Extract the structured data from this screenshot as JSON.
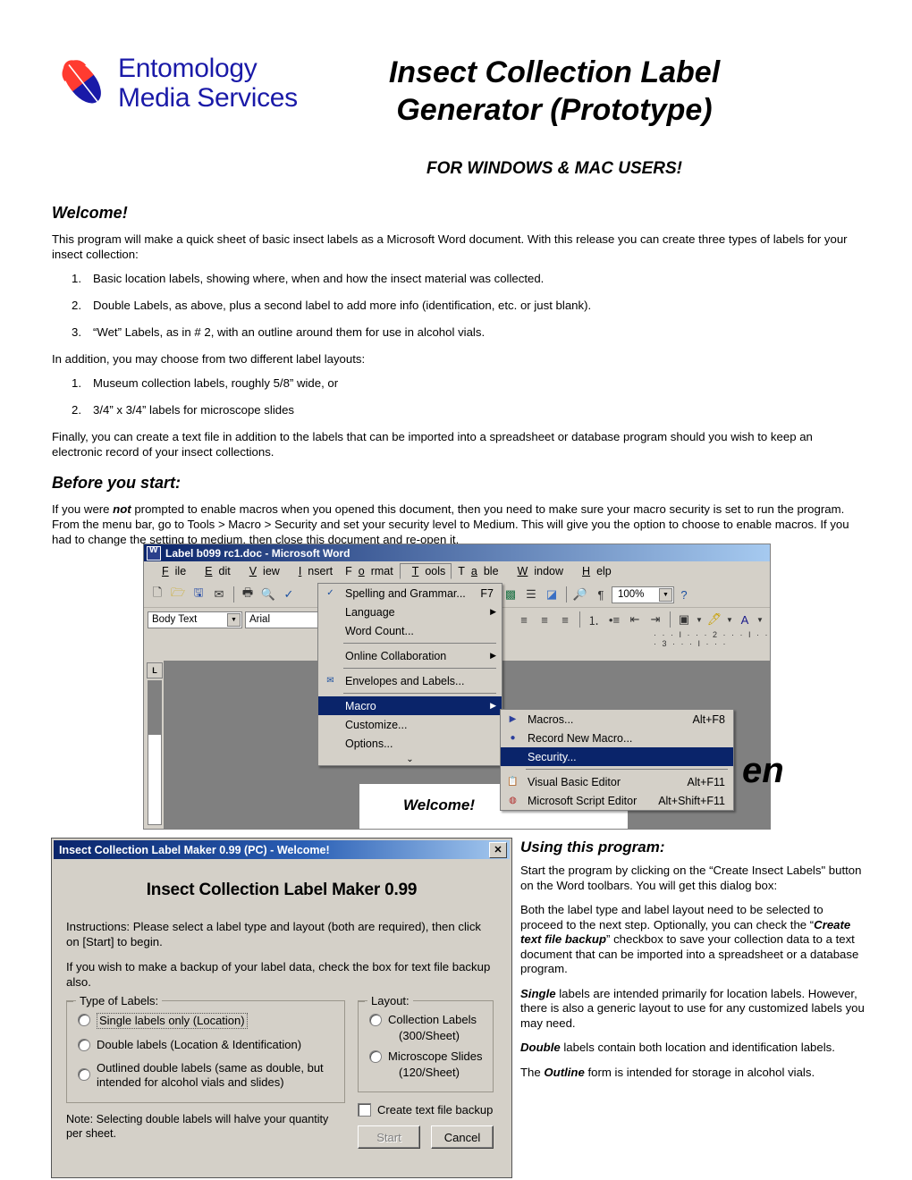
{
  "header": {
    "logo_line1": "Entomology",
    "logo_line2": "Media Services",
    "title": "Insect Collection Label Generator (Prototype)",
    "subtitle": "FOR WINDOWS & MAC USERS!",
    "logo_blue": "#1a1aa8",
    "logo_red": "#ff3b30"
  },
  "welcome": {
    "heading": "Welcome!",
    "intro": "This program will make a quick sheet of basic insect labels as a Microsoft Word document.  With this release you can create three types of labels for your insect collection:",
    "list1": [
      "Basic location labels, showing where, when and how the insect material was collected.",
      "Double Labels, as above, plus a second label to add more info (identification, etc. or just blank).",
      "“Wet” Labels, as in # 2, with an outline around them for use in alcohol vials."
    ],
    "layouts_intro": "In addition, you may choose from two different label layouts:",
    "list2": [
      "Museum collection labels, roughly 5/8” wide, or",
      "3/4” x 3/4” labels for microscope slides"
    ],
    "finally": "Finally, you can create a text file in addition to the labels that can be imported into a spreadsheet or database program should you wish to keep an electronic record of your insect collections."
  },
  "before": {
    "heading": "Before you start:",
    "text_a": "If you were ",
    "text_b": "not",
    "text_c": " prompted to enable macros when you opened this document, then you need to make sure your macro security is set to run the program.  From the menu bar, go to Tools > Macro > Security and set your security level to Medium.  This will give you the option to choose to enable macros.  If you had to change the setting to medium, then close this document and re-open it."
  },
  "word": {
    "title": "Label b099 rc1.doc - Microsoft Word",
    "menubar": [
      "File",
      "Edit",
      "View",
      "Insert",
      "Format",
      "Tools",
      "Table",
      "Window",
      "Help"
    ],
    "style_combo": "Body Text",
    "font_combo": "Arial",
    "zoom": "100%",
    "ruler_marks": "·  ·  ·  I  ·  ·  ·  2  ·  ·  ·  I  ·  ·  ·  3  ·  ·  ·  I  ·  ·  ·",
    "doc_welcome": "Welcome!",
    "doc_bigtext": "en",
    "tools_menu": [
      {
        "label": "Spelling and Grammar...",
        "accel": "F7",
        "icon": "spellcheck-icon",
        "submenu": false
      },
      {
        "label": "Language",
        "accel": "",
        "icon": "",
        "submenu": true
      },
      {
        "label": "Word Count...",
        "accel": "",
        "icon": "",
        "submenu": false
      },
      {
        "label": "Online Collaboration",
        "accel": "",
        "icon": "",
        "submenu": true
      },
      {
        "label": "Envelopes and Labels...",
        "accel": "",
        "icon": "envelope-icon",
        "submenu": false
      },
      {
        "label": "Macro",
        "accel": "",
        "icon": "",
        "submenu": true,
        "selected": true
      },
      {
        "label": "Customize...",
        "accel": "",
        "icon": "",
        "submenu": false
      },
      {
        "label": "Options...",
        "accel": "",
        "icon": "",
        "submenu": false
      }
    ],
    "macro_menu": [
      {
        "label": "Macros...",
        "accel": "Alt+F8",
        "icon": "play-icon",
        "selected": false
      },
      {
        "label": "Record New Macro...",
        "accel": "",
        "icon": "record-icon",
        "selected": false
      },
      {
        "label": "Security...",
        "accel": "",
        "icon": "",
        "selected": true
      },
      {
        "label": "Visual Basic Editor",
        "accel": "Alt+F11",
        "icon": "vb-icon",
        "selected": false
      },
      {
        "label": "Microsoft Script Editor",
        "accel": "Alt+Shift+F11",
        "icon": "script-icon",
        "selected": false
      }
    ]
  },
  "dialog": {
    "title": "Insect Collection Label Maker 0.99 (PC) - Welcome!",
    "close_label": "✕",
    "heading": "Insect Collection Label Maker 0.99",
    "instructions1": "Instructions: Please select a label type and layout (both are required), then click on [Start] to begin.",
    "instructions2": "If you wish to make a backup of your label data, check the box for text file backup also.",
    "type_legend": "Type of Labels:",
    "type_options": [
      "Single labels only (Location)",
      "Double labels (Location & Identification)",
      "Outlined double labels (same as double, but intended for alcohol vials and slides)"
    ],
    "note": "Note: Selecting double labels will halve your quantity per sheet.",
    "layout_legend": "Layout:",
    "layout_options": [
      {
        "label": "Collection Labels",
        "count": "(300/Sheet)"
      },
      {
        "label": "Microscope Slides",
        "count": "(120/Sheet)"
      }
    ],
    "checkbox_label": "Create text file backup",
    "start_label": "Start",
    "cancel_label": "Cancel"
  },
  "using": {
    "heading": "Using this program:",
    "p1": "Start the program by clicking on the “Create Insect Labels\" button on the Word toolbars. You will get this dialog box:",
    "p2_a": "Both the label type and label layout need to be selected to proceed to the next step.  Optionally, you can check the “",
    "p2_b": "Create text file backup",
    "p2_c": "” checkbox to save your collection data to a text document that can be imported into a spreadsheet or a database program.",
    "p3_a": "Single",
    "p3_b": " labels are intended primarily for location labels. However, there is also a generic layout to use for any customized labels you may need.",
    "p4_a": "Double",
    "p4_b": " labels contain both location and identification labels.",
    "p5_a": "The ",
    "p5_b": "Outline",
    "p5_c": " form is intended for storage in alcohol vials."
  }
}
